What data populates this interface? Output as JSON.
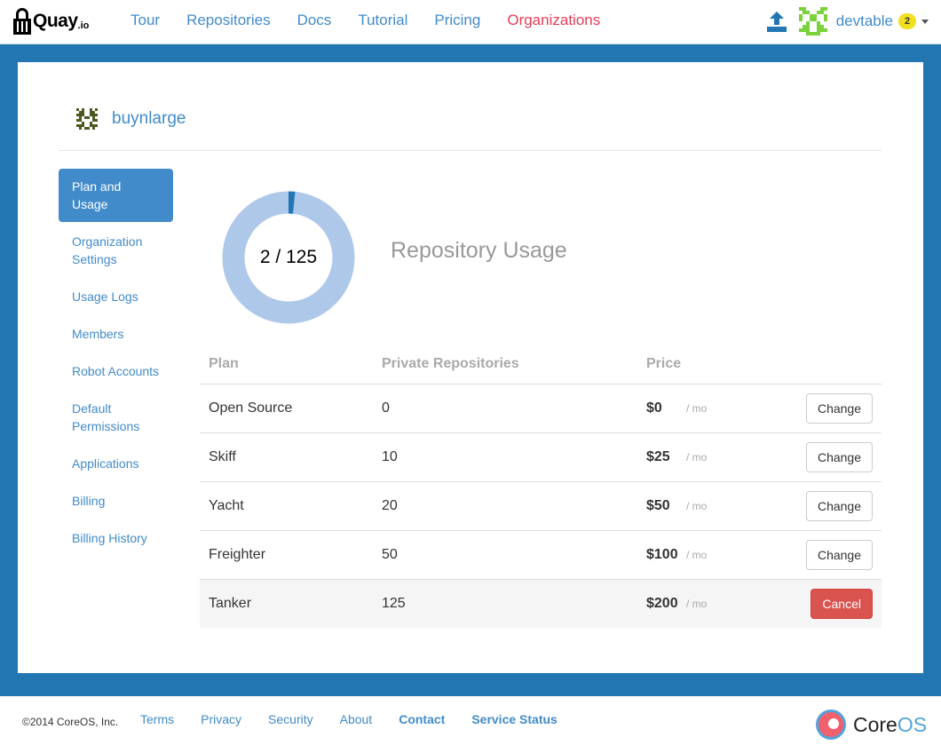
{
  "navbar": {
    "brand_name": "Quay",
    "brand_tld": ".io",
    "links": [
      {
        "label": "Tour"
      },
      {
        "label": "Repositories"
      },
      {
        "label": "Docs"
      },
      {
        "label": "Tutorial"
      },
      {
        "label": "Pricing"
      },
      {
        "label": "Organizations",
        "active": true
      }
    ],
    "user": {
      "name": "devtable",
      "notification_count": "2"
    }
  },
  "org": {
    "name": "buynlarge"
  },
  "sidenav": {
    "items": [
      {
        "label": "Plan and Usage",
        "active": true
      },
      {
        "label": "Organization Settings"
      },
      {
        "label": "Usage Logs"
      },
      {
        "label": "Members"
      },
      {
        "label": "Robot Accounts"
      },
      {
        "label": "Default Permissions"
      },
      {
        "label": "Applications"
      },
      {
        "label": "Billing"
      },
      {
        "label": "Billing History"
      }
    ]
  },
  "usage": {
    "used": 2,
    "total": 125,
    "label": "2 / 125",
    "title": "Repository Usage"
  },
  "plans_table": {
    "headers": {
      "plan": "Plan",
      "repos": "Private Repositories",
      "price": "Price"
    },
    "per_label": "/ mo",
    "rows": [
      {
        "plan": "Open Source",
        "repos": "0",
        "price": "$0",
        "action": "Change",
        "current": false
      },
      {
        "plan": "Skiff",
        "repos": "10",
        "price": "$25",
        "action": "Change",
        "current": false
      },
      {
        "plan": "Yacht",
        "repos": "20",
        "price": "$50",
        "action": "Change",
        "current": false
      },
      {
        "plan": "Freighter",
        "repos": "50",
        "price": "$100",
        "action": "Change",
        "current": false
      },
      {
        "plan": "Tanker",
        "repos": "125",
        "price": "$200",
        "action": "Cancel",
        "current": true
      }
    ]
  },
  "footer": {
    "copyright": "©2014 CoreOS, Inc.",
    "links": [
      {
        "label": "Terms"
      },
      {
        "label": "Privacy"
      },
      {
        "label": "Security"
      },
      {
        "label": "About"
      },
      {
        "label": "Contact",
        "bold": true
      },
      {
        "label": "Service Status",
        "bold": true
      }
    ],
    "logo_core": "Core",
    "logo_os": "OS"
  },
  "colors": {
    "band": "#2277b3",
    "link": "#428bca",
    "active_nav": "#e53d56",
    "donut_track": "#aec8ea",
    "donut_fill": "#2277b3",
    "danger": "#d9534f"
  }
}
